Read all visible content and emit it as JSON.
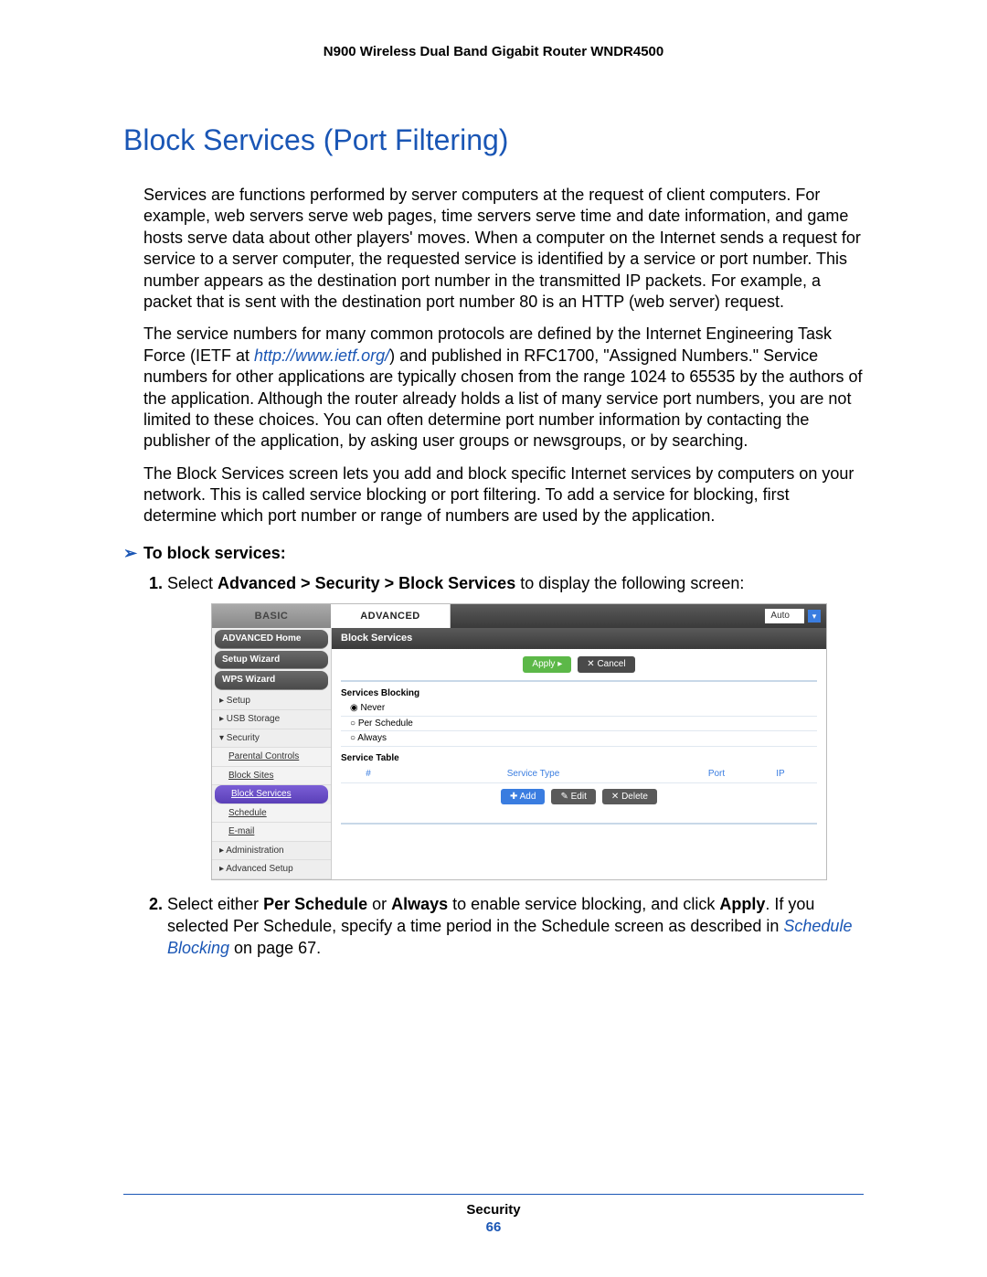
{
  "header": {
    "product": "N900 Wireless Dual Band Gigabit Router WNDR4500"
  },
  "title": "Block Services (Port Filtering)",
  "para1": "Services are functions performed by server computers at the request of client computers. For example, web servers serve web pages, time servers serve time and date information, and game hosts serve data about other players' moves. When a computer on the Internet sends a request for service to a server computer, the requested service is identified by a service or port number. This number appears as the destination port number in the transmitted IP packets. For example, a packet that is sent with the destination port number 80 is an HTTP (web server) request.",
  "para2_pre": "The service numbers for many common protocols are defined by the Internet Engineering Task Force (IETF at ",
  "para2_link": "http://www.ietf.org/",
  "para2_post": ") and published in RFC1700, \"Assigned Numbers.\" Service numbers for other applications are typically chosen from the range 1024 to 65535 by the authors of the application. Although the router already holds a list of many service port numbers, you are not limited to these choices. You can often determine port number information by contacting the publisher of the application, by asking user groups or newsgroups, or by searching.",
  "para3": "The Block Services screen lets you add and block specific Internet services by computers on your network. This is called service blocking or port filtering. To add a service for blocking, first determine which port number or range of numbers are used by the application.",
  "procedure_title": "To block services:",
  "step1_pre": "Select ",
  "step1_bold": "Advanced > Security > Block Services",
  "step1_post": " to display the following screen:",
  "step2_a": "Select either ",
  "step2_b": "Per Schedule",
  "step2_c": " or ",
  "step2_d": "Always",
  "step2_e": " to enable service blocking, and click ",
  "step2_f": "Apply",
  "step2_g": ". If you selected Per Schedule, specify a time period in the Schedule screen as described in ",
  "step2_link": "Schedule Blocking",
  "step2_h": " on page 67.",
  "router": {
    "tab_basic": "BASIC",
    "tab_advanced": "ADVANCED",
    "auto": "Auto",
    "sidebar": {
      "advanced_home": "ADVANCED Home",
      "setup_wizard": "Setup Wizard",
      "wps_wizard": "WPS Wizard",
      "setup": "▸ Setup",
      "usb": "▸ USB Storage",
      "security": "▾ Security",
      "parental": "Parental Controls",
      "block_sites": "Block Sites",
      "block_services": "Block Services",
      "schedule": "Schedule",
      "email": "E-mail",
      "admin": "▸ Administration",
      "adv_setup": "▸ Advanced Setup"
    },
    "main": {
      "title": "Block Services",
      "apply": "Apply ▸",
      "cancel": "✕ Cancel",
      "services_blocking": "Services Blocking",
      "never": "Never",
      "per_schedule": "Per Schedule",
      "always": "Always",
      "service_table": "Service Table",
      "col_num": "#",
      "col_type": "Service Type",
      "col_port": "Port",
      "col_ip": "IP",
      "add": "✚ Add",
      "edit": "✎ Edit",
      "delete": "✕ Delete"
    }
  },
  "footer": {
    "section": "Security",
    "page": "66"
  }
}
